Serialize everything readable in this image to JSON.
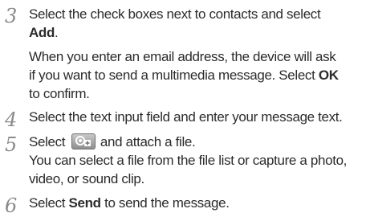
{
  "steps": [
    {
      "number": "3",
      "line1_text": "Select the check boxes next to contacts and select",
      "line2_bold": "Add",
      "line2_after": ".",
      "line3": "When you enter an email address, the device will ask",
      "line4_before": "if you want to send a multimedia message. Select ",
      "line4_bold": "OK",
      "line5": "to confirm."
    },
    {
      "number": "4",
      "line1": "Select the text input field and enter your message text."
    },
    {
      "number": "5",
      "line1_before": "Select",
      "icon": "attach-file-icon",
      "line1_after": "and attach a file.",
      "line2": "You can select a file from the file list or capture a photo,",
      "line3": "video, or sound clip."
    },
    {
      "number": "6",
      "line1_before": "Select ",
      "line1_bold": "Send",
      "line1_after": " to send the message."
    }
  ]
}
